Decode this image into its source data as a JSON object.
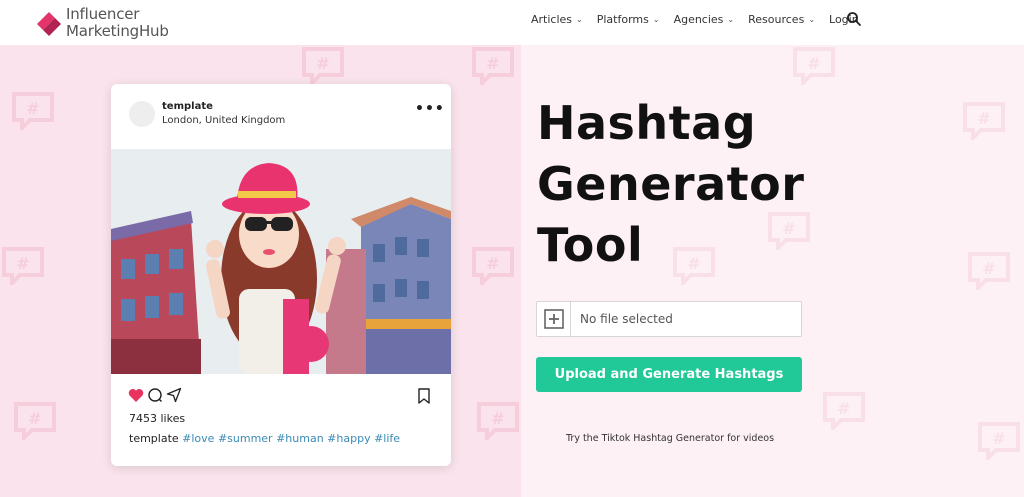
{
  "brand": {
    "line1": "Influencer",
    "line2": "MarketingHub",
    "icon": "influencer-marketing-hub-logo",
    "colors": {
      "primary": "#e4346c",
      "dark": "#b02352"
    }
  },
  "nav": {
    "items": [
      {
        "label": "Articles",
        "dropdown": true
      },
      {
        "label": "Platforms",
        "dropdown": true
      },
      {
        "label": "Agencies",
        "dropdown": true
      },
      {
        "label": "Resources",
        "dropdown": true
      },
      {
        "label": "Login",
        "dropdown": false
      }
    ],
    "search_icon": "search-icon"
  },
  "post": {
    "username": "template",
    "location": "London, United Kingdom",
    "likes": "7453 likes",
    "caption_user": "template",
    "hashtags": [
      "#love",
      "#summer",
      "#human",
      "#happy",
      "#life"
    ],
    "icons": [
      "heart-icon",
      "comment-icon",
      "share-icon",
      "bookmark-icon",
      "more-icon"
    ]
  },
  "hero": {
    "title_line1": "Hashtag",
    "title_line2": "Generator",
    "title_line3": "Tool",
    "file_placeholder": "No file selected",
    "upload_label": "Upload and Generate Hashtags",
    "tiktok_link": "Try the Tiktok Hashtag Generator for videos"
  },
  "colors": {
    "accent_green": "#20c997",
    "bg_pink": "#fae3ec",
    "bg_light": "#fdf1f5",
    "hashtag_blue": "#3a8bb5",
    "heart_red": "#e8335f"
  }
}
